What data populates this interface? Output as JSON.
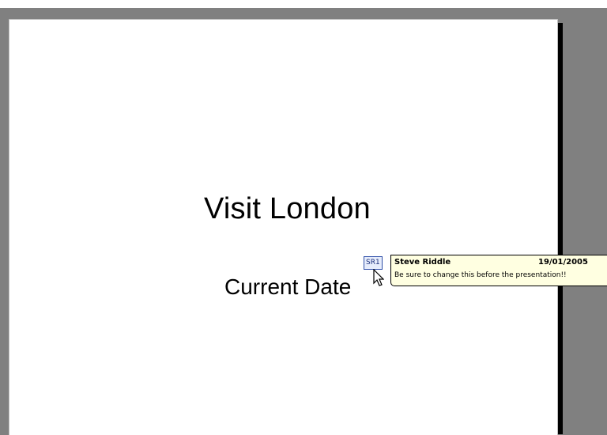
{
  "colors": {
    "workspace": "#808080",
    "slide": "#ffffff",
    "tooltip_bg": "#ffffe1",
    "marker_border": "#2f4fa8"
  },
  "slide": {
    "title": "Visit London",
    "subtitle": "Current Date"
  },
  "comment_marker": {
    "label": "SR1"
  },
  "comment_tooltip": {
    "author": "Steve Riddle",
    "date": "19/01/2005",
    "text": "Be sure to change this before the presentation!!"
  },
  "cursor": {
    "icon": "arrow-cursor-icon"
  }
}
